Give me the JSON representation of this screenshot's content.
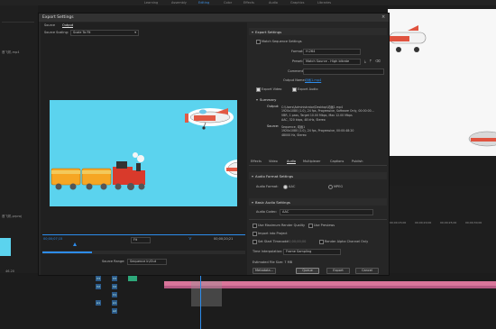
{
  "app": {
    "topbar": [
      "Learning",
      "Assembly",
      "Editing",
      "Color",
      "Effects",
      "Audio",
      "Graphics",
      "Libraries"
    ],
    "left_panel": [
      "首飞机.mp4",
      "首飞机.prproj",
      "46.20",
      "00:00:00:00"
    ],
    "right_timecodes": [
      "00;00;15;00",
      "00;00;20;00",
      "00;00;25;00",
      "00;00;30;00"
    ]
  },
  "dialog": {
    "title": "Export Settings",
    "preview": {
      "tabs": [
        "Source",
        "Output"
      ],
      "source_scaling_label": "Source Scaling:",
      "source_scaling_value": "Scale To Fit",
      "timecode_start": "00;00;07;15",
      "timecode_end": "00;00;20;21",
      "fit_value": "Fit",
      "source_range_label": "Source Range:",
      "source_range_value": "Sequence In/Out"
    },
    "export_settings": {
      "section": "Export Settings",
      "match_sequence": "Match Sequence Settings",
      "format_label": "Format:",
      "format_value": "H.264",
      "preset_label": "Preset:",
      "preset_value": "Match Source - High bitrate",
      "comments_label": "Comments:",
      "output_name_label": "Output Name:",
      "output_name_value": "动画1.mp4",
      "export_video": "Export Video",
      "export_audio": "Export Audio"
    },
    "summary": {
      "title": "Summary",
      "output_label": "Output:",
      "output_lines": [
        "C:\\Users\\Administrator\\Desktop\\动画1.mp4",
        "1920x1080 (1.0), 24 fps, Progressive, Software Only, 00:00:00...",
        "VBR, 1 pass, Target 10.00 Mbps, Max 12.00 Mbps",
        "AAC, 320 kbps, 48 kHz, Stereo"
      ],
      "source_label": "Source:",
      "source_lines": [
        "Sequence, 动画1",
        "1920x1080 (1.0), 24 fps, Progressive, 00:00:48:20",
        "48000 Hz, Stereo"
      ]
    },
    "tabs": [
      "Effects",
      "Video",
      "Audio",
      "Multiplexer",
      "Captions",
      "Publish"
    ],
    "audio": {
      "format_section": "Audio Format Settings",
      "format_label": "Audio Format:",
      "aac": "AAC",
      "mpeg": "MPEG",
      "basic_section": "Basic Audio Settings",
      "codec_label": "Audio Codec:",
      "codec_value": "AAC"
    },
    "options": {
      "max_quality": "Use Maximum Render Quality",
      "use_previews": "Use Previews",
      "import_project": "Import into Project",
      "set_timecode": "Set Start Timecode",
      "timecode": "00;00;00;00",
      "render_alpha": "Render Alpha Channel Only",
      "time_interp_label": "Time Interpolation:",
      "time_interp_value": "Frame Sampling",
      "file_size": "Estimated File Size:  7 MB"
    },
    "buttons": {
      "metadata": "Metadata...",
      "queue": "Queue",
      "export": "Export",
      "cancel": "Cancel"
    }
  },
  "colors": {
    "sky": "#5bd3ee",
    "accent": "#2d8ceb",
    "clip": "#d9759a"
  }
}
